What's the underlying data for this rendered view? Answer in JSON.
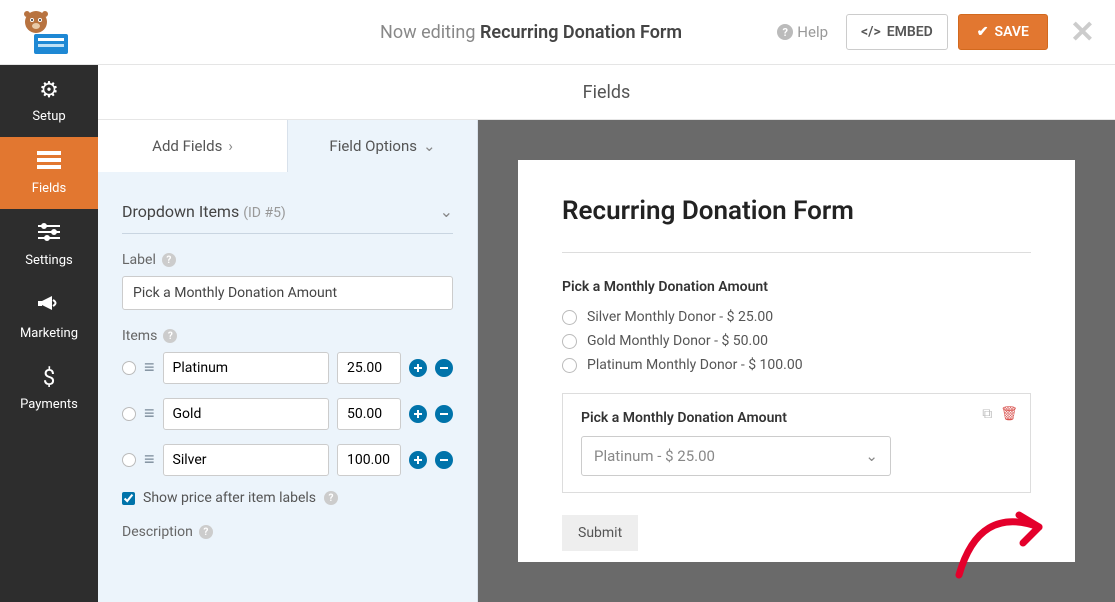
{
  "header": {
    "now_editing_prefix": "Now editing ",
    "form_name": "Recurring Donation Form",
    "help_label": "Help",
    "embed_label": "EMBED",
    "save_label": "SAVE"
  },
  "nav": {
    "setup": "Setup",
    "fields": "Fields",
    "settings": "Settings",
    "marketing": "Marketing",
    "payments": "Payments"
  },
  "subheader_title": "Fields",
  "panel": {
    "tab_add": "Add Fields",
    "tab_options": "Field Options",
    "section_title": "Dropdown Items",
    "section_id": "(ID #5)",
    "label_label": "Label",
    "label_value": "Pick a Monthly Donation Amount",
    "items_label": "Items",
    "items": [
      {
        "name": "Platinum",
        "price": "25.00"
      },
      {
        "name": "Gold",
        "price": "50.00"
      },
      {
        "name": "Silver",
        "price": "100.00"
      }
    ],
    "show_price_label": "Show price after item labels",
    "description_label": "Description"
  },
  "preview": {
    "form_title": "Recurring Donation Form",
    "question1_label": "Pick a Monthly Donation Amount",
    "options": [
      "Silver Monthly Donor - $ 25.00",
      "Gold Monthly Donor - $ 50.00",
      "Platinum Monthly Donor - $ 100.00"
    ],
    "question2_label": "Pick a Monthly Donation Amount",
    "select_value": "Platinum - $ 25.00",
    "submit_label": "Submit"
  }
}
